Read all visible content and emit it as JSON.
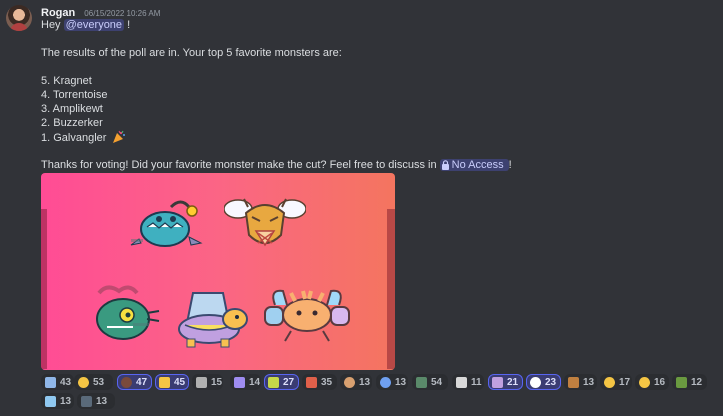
{
  "message": {
    "username": "Rogan",
    "timestamp": "06/15/2022 10:26 AM",
    "greeting": "Hey",
    "mention": "@everyone",
    "greeting_end": "!",
    "intro": "The results of the poll are in. Your top 5 favorite monsters are:",
    "list": [
      "5. Kragnet",
      "4. Torrentoise",
      "3. Amplikewt",
      "2. Buzzerker",
      "1. Galvangler"
    ],
    "thanks": "Thanks for voting! Did your favorite monster make the cut? Feel free to discuss in",
    "channel": "No Access",
    "thanks_end": "!"
  },
  "image": {
    "gradient_start": "#ff4c95",
    "gradient_end": "#f4755f"
  },
  "reactions": [
    {
      "emoji": "flag-icon",
      "count": "43",
      "active": false,
      "color": "#8fb6e8"
    },
    {
      "emoji": "scream-face-icon",
      "count": "53",
      "active": false,
      "color": "#f4c544"
    },
    {
      "emoji": "heart-icon",
      "count": "47",
      "active": true,
      "color": "#7a4a3b"
    },
    {
      "emoji": "thumbs-up-icon",
      "count": "45",
      "active": true,
      "color": "#f4c544"
    },
    {
      "emoji": "raccoon-icon",
      "count": "15",
      "active": false,
      "color": "#b0b0b0"
    },
    {
      "emoji": "tamagotchi-icon",
      "count": "14",
      "active": false,
      "color": "#9e8cf0"
    },
    {
      "emoji": "frog-thumbs-icon",
      "count": "27",
      "active": true,
      "color": "#c6d84a"
    },
    {
      "emoji": "rainbow-flag-icon",
      "count": "35",
      "active": false,
      "color": "#e0604a"
    },
    {
      "emoji": "cookie-icon",
      "count": "13",
      "active": false,
      "color": "#d8a070"
    },
    {
      "emoji": "blue-heart-icon",
      "count": "13",
      "active": false,
      "color": "#6fa0f0"
    },
    {
      "emoji": "monster-cat-icon",
      "count": "54",
      "active": false,
      "color": "#5a8a6a"
    },
    {
      "emoji": "trophy-card-icon",
      "count": "11",
      "active": false,
      "color": "#d8d8d8"
    },
    {
      "emoji": "sparkle-wand-icon",
      "count": "21",
      "active": true,
      "color": "#c0a0e0"
    },
    {
      "emoji": "eyes-icon",
      "count": "23",
      "active": true,
      "color": "#ffffff"
    },
    {
      "emoji": "dancing-monster-icon",
      "count": "13",
      "active": false,
      "color": "#c08040"
    },
    {
      "emoji": "ok-hand-icon",
      "count": "17",
      "active": false,
      "color": "#f4c544"
    },
    {
      "emoji": "smile-face-icon",
      "count": "16",
      "active": false,
      "color": "#f4c544"
    },
    {
      "emoji": "pickle-icon",
      "count": "12",
      "active": false,
      "color": "#6a9a40"
    },
    {
      "emoji": "snowflake-icon",
      "count": "13",
      "active": false,
      "color": "#8fc8f0"
    },
    {
      "emoji": "sword-icon",
      "count": "13",
      "active": false,
      "color": "#5a6a7a"
    }
  ]
}
